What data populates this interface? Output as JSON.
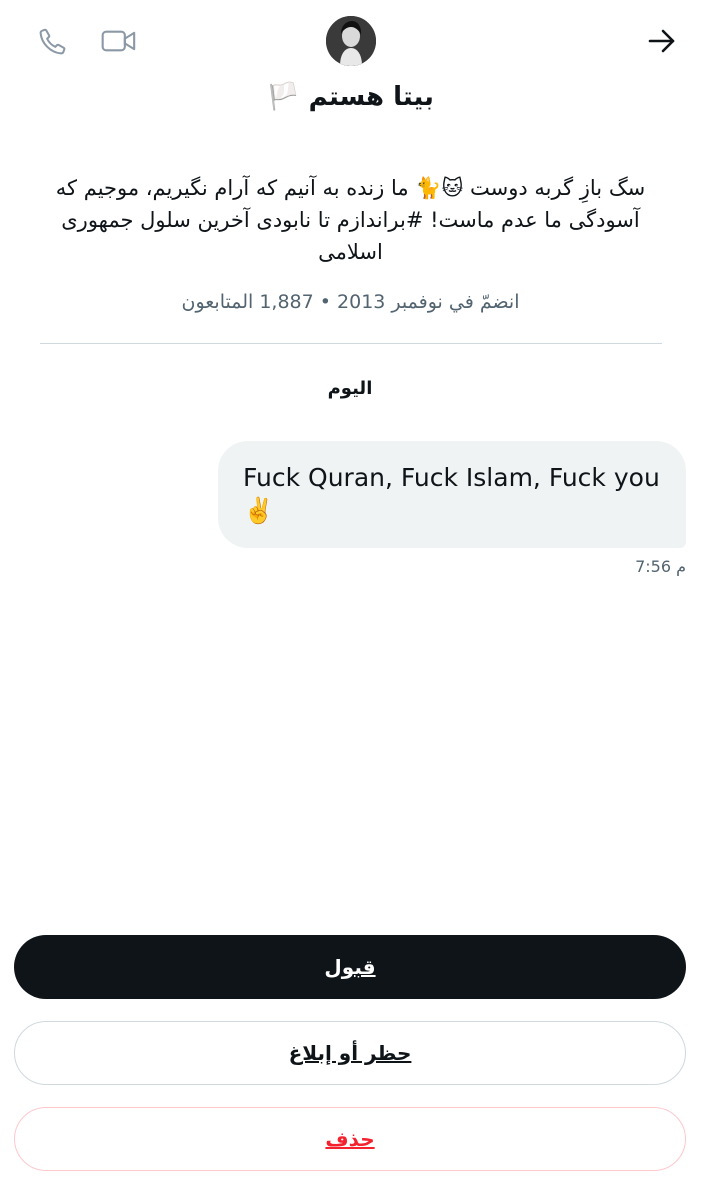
{
  "header": {
    "call_icon": "phone-icon",
    "video_icon": "video-camera-icon",
    "back_icon": "arrow-right-icon"
  },
  "profile": {
    "display_name": "بیتا هستم 🏳️",
    "bio": "سگ بازِ گربه دوست 🐱🐈 ما زنده به آنیم که آرام نگیریم، موجیم که آسودگی ما عدم ماست! #براندازم تا نابودی آخرین سلول جمهوری اسلامی",
    "meta": "انضمّ في نوفمبر 2013 • 1,887 المتابعون"
  },
  "conversation": {
    "date_separator": "اليوم",
    "messages": [
      {
        "text": "Fuck Quran, Fuck Islam, Fuck you ✌️",
        "time": "7:56 م"
      }
    ]
  },
  "actions": {
    "accept_label": "قبول",
    "block_label": "حظر أو إبلاغ",
    "delete_label": "حذف"
  },
  "colors": {
    "accent_dark": "#0f1419",
    "danger": "#f4212e",
    "bubble_bg": "#eff3f4",
    "muted_text": "#536471"
  }
}
